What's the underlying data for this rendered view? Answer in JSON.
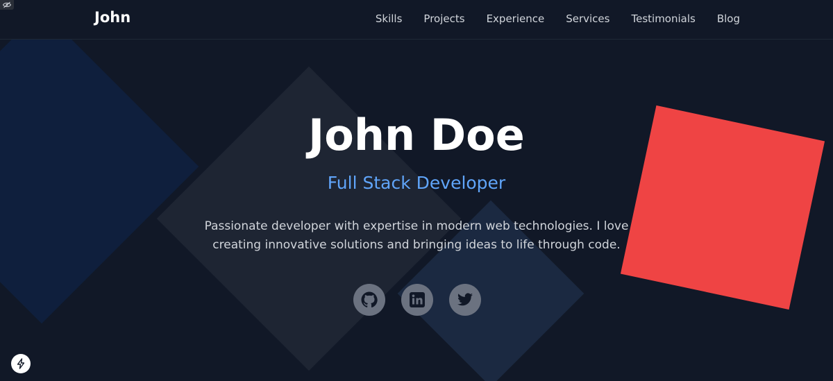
{
  "nav": {
    "brand": "John",
    "links": [
      "Skills",
      "Projects",
      "Experience",
      "Services",
      "Testimonials",
      "Blog"
    ]
  },
  "hero": {
    "name": "John Doe",
    "role": "Full Stack Developer",
    "bio_line1": "Passionate developer with expertise in modern web technologies. I love",
    "bio_line2": "creating innovative solutions and bringing ideas to life through code."
  },
  "socials": [
    {
      "icon": "github-icon"
    },
    {
      "icon": "linkedin-icon"
    },
    {
      "icon": "twitter-icon"
    }
  ],
  "colors": {
    "background": "#111827",
    "accent_blue": "#60a5fa",
    "accent_red": "#ef4444",
    "social_bg": "#6b7280"
  }
}
